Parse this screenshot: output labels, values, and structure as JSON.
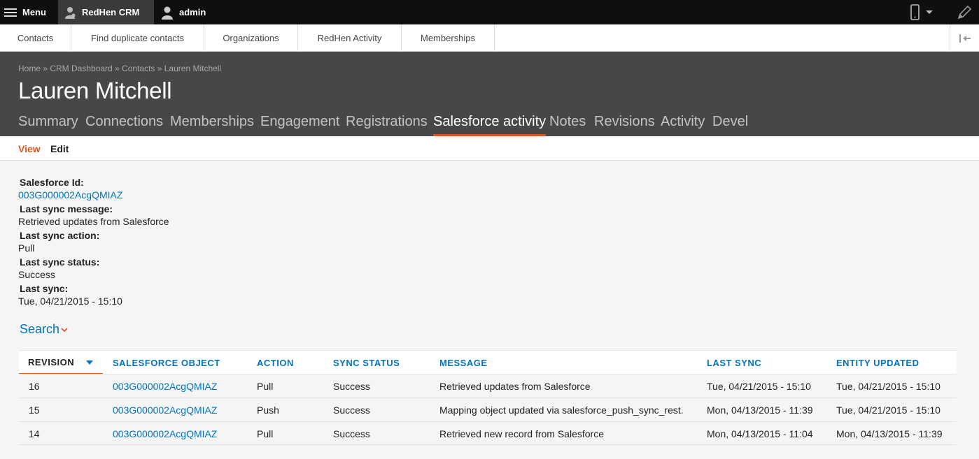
{
  "toolbar": {
    "menu_label": "Menu",
    "crm_label": "RedHen CRM",
    "admin_label": "admin"
  },
  "tray": {
    "items": [
      {
        "label": "Contacts"
      },
      {
        "label": "Find duplicate contacts"
      },
      {
        "label": "Organizations"
      },
      {
        "label": "RedHen Activity"
      },
      {
        "label": "Memberships"
      }
    ]
  },
  "header": {
    "breadcrumb": "Home » CRM Dashboard » Contacts » Lauren Mitchell",
    "title": "Lauren Mitchell",
    "tabs": [
      {
        "label": "Summary"
      },
      {
        "label": "Connections"
      },
      {
        "label": "Memberships"
      },
      {
        "label": "Engagement"
      },
      {
        "label": "Registrations"
      },
      {
        "label": "Salesforce activity",
        "active": true
      },
      {
        "label": "Notes"
      },
      {
        "label": "Revisions"
      },
      {
        "label": "Activity"
      },
      {
        "label": "Devel"
      }
    ]
  },
  "subtabs": {
    "view": "View",
    "edit": "Edit"
  },
  "fields": [
    {
      "label": "Salesforce Id:",
      "value": "003G000002AcgQMIAZ",
      "link": true
    },
    {
      "label": "Last sync message:",
      "value": "Retrieved updates from Salesforce"
    },
    {
      "label": "Last sync action:",
      "value": "Pull"
    },
    {
      "label": "Last sync status:",
      "value": "Success"
    },
    {
      "label": "Last sync:",
      "value": "Tue, 04/21/2015 - 15:10"
    }
  ],
  "search": {
    "label": "Search"
  },
  "table": {
    "headers": [
      "REVISION",
      "SALESFORCE OBJECT",
      "ACTION",
      "SYNC STATUS",
      "MESSAGE",
      "LAST SYNC",
      "ENTITY UPDATED"
    ],
    "rows": [
      [
        "16",
        "003G000002AcgQMIAZ",
        "Pull",
        "Success",
        "Retrieved updates from Salesforce",
        "Tue, 04/21/2015 - 15:10",
        "Tue, 04/21/2015 - 15:10"
      ],
      [
        "15",
        "003G000002AcgQMIAZ",
        "Push",
        "Success",
        "Mapping object updated via salesforce_push_sync_rest.",
        "Mon, 04/13/2015 - 11:39",
        "Tue, 04/21/2015 - 15:10"
      ],
      [
        "14",
        "003G000002AcgQMIAZ",
        "Pull",
        "Success",
        "Retrieved new record from Salesforce",
        "Mon, 04/13/2015 - 11:04",
        "Mon, 04/13/2015 - 11:39"
      ]
    ]
  },
  "colors": {
    "accent": "#e0531e",
    "link": "#0074bd",
    "header_bg": "#474747",
    "toolbar_bg": "#0f0f0f"
  }
}
